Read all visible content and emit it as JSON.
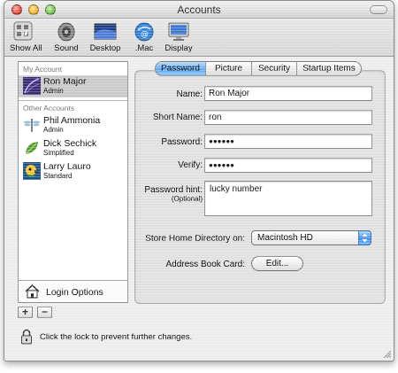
{
  "window": {
    "title": "Accounts"
  },
  "toolbar": {
    "items": [
      {
        "label": "Show All",
        "icon": "show-all-icon"
      },
      {
        "label": "Sound",
        "icon": "speaker-icon"
      },
      {
        "label": "Desktop",
        "icon": "desktop-icon"
      },
      {
        "label": ".Mac",
        "icon": "dotmac-icon"
      },
      {
        "label": "Display",
        "icon": "display-icon"
      }
    ]
  },
  "sidebar": {
    "my_account_header": "My Account",
    "other_accounts_header": "Other Accounts",
    "my_account": {
      "name": "Ron Major",
      "role": "Admin",
      "icon": "avatar-purple-icon"
    },
    "others": [
      {
        "name": "Phil Ammonia",
        "role": "Admin",
        "icon": "dragonfly-avatar-icon"
      },
      {
        "name": "Dick Sechick",
        "role": "Simplified",
        "icon": "leaf-avatar-icon"
      },
      {
        "name": "Larry Lauro",
        "role": "Standard",
        "icon": "parrot-avatar-icon"
      }
    ],
    "login_options_label": "Login Options",
    "add_label": "+",
    "remove_label": "−"
  },
  "tabs": [
    {
      "label": "Password",
      "active": true
    },
    {
      "label": "Picture",
      "active": false
    },
    {
      "label": "Security",
      "active": false
    },
    {
      "label": "Startup Items",
      "active": false
    }
  ],
  "form": {
    "name_label": "Name:",
    "name_value": "Ron Major",
    "short_name_label": "Short Name:",
    "short_name_value": "ron",
    "password_label": "Password:",
    "password_value": "●●●●●●",
    "verify_label": "Verify:",
    "verify_value": "●●●●●●",
    "hint_label": "Password hint:",
    "hint_sublabel": "(Optional)",
    "hint_value": "lucky number",
    "home_dir_label": "Store Home Directory on:",
    "home_dir_value": "Macintosh HD",
    "address_card_label": "Address Book Card:",
    "edit_button_label": "Edit..."
  },
  "footer": {
    "lock_text": "Click the lock to prevent further changes."
  },
  "colors": {
    "tab_active": "#5ca8ef",
    "selection": "#c9c9c9"
  }
}
